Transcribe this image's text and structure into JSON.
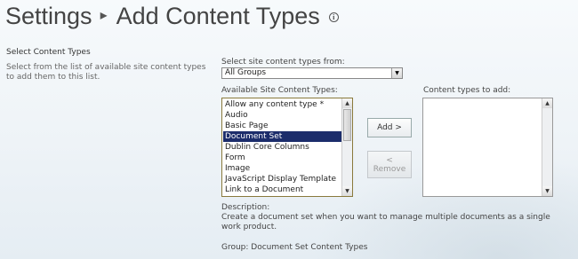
{
  "header": {
    "settings_label": "Settings",
    "separator": "▸",
    "page_title": "Add Content Types",
    "info_icon_glyph": "i",
    "info_icon": "info-icon"
  },
  "section": {
    "title": "Select Content Types",
    "description": "Select from the list of available site content types to add them to this list."
  },
  "source": {
    "label": "Select site content types from:",
    "selected": "All Groups"
  },
  "available": {
    "label": "Available Site Content Types:",
    "items": [
      "Allow any content type *",
      "Audio",
      "Basic Page",
      "Document Set",
      "Dublin Core Columns",
      "Form",
      "Image",
      "JavaScript Display Template",
      "Link to a Document"
    ],
    "selected_index": 3
  },
  "added": {
    "label": "Content types to add:"
  },
  "buttons": {
    "add": "Add >",
    "remove_arrow": "<",
    "remove": "Remove"
  },
  "details": {
    "description_label": "Description:",
    "description_text": "Create a document set when you want to manage multiple documents as a single work product.",
    "group_text": "Group: Document Set Content Types"
  },
  "colors": {
    "selection_bg": "#1c2d6b",
    "listbox_border": "#8a7a3c"
  }
}
